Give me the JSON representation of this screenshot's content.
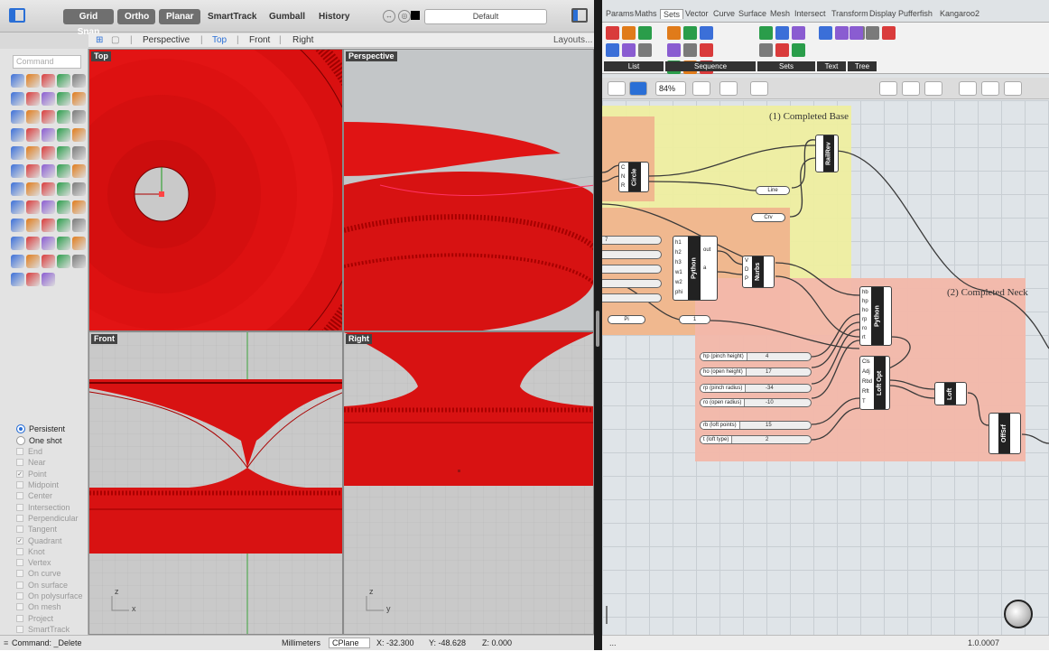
{
  "rhino": {
    "toolbar": {
      "grid_snap": "Grid Snap",
      "ortho": "Ortho",
      "planar": "Planar",
      "smarttrack": "SmartTrack",
      "gumball": "Gumball",
      "history": "History",
      "layer": "Default"
    },
    "viewport_tabs": [
      "Perspective",
      "Top",
      "Front",
      "Right"
    ],
    "active_tab": "Top",
    "layouts_label": "Layouts...",
    "command_placeholder": "Command",
    "viewports": {
      "top": "Top",
      "perspective": "Perspective",
      "front": "Front",
      "right": "Right"
    },
    "osnap": {
      "persistent": "Persistent",
      "one_shot": "One shot",
      "items": [
        {
          "label": "End",
          "checked": false
        },
        {
          "label": "Near",
          "checked": false
        },
        {
          "label": "Point",
          "checked": true
        },
        {
          "label": "Midpoint",
          "checked": false
        },
        {
          "label": "Center",
          "checked": false
        },
        {
          "label": "Intersection",
          "checked": false
        },
        {
          "label": "Perpendicular",
          "checked": false
        },
        {
          "label": "Tangent",
          "checked": false
        },
        {
          "label": "Quadrant",
          "checked": true
        },
        {
          "label": "Knot",
          "checked": false
        },
        {
          "label": "Vertex",
          "checked": false
        },
        {
          "label": "On curve",
          "checked": false
        },
        {
          "label": "On surface",
          "checked": false
        },
        {
          "label": "On polysurface",
          "checked": false
        },
        {
          "label": "On mesh",
          "checked": false
        },
        {
          "label": "Project",
          "checked": false
        },
        {
          "label": "SmartTrack",
          "checked": false
        }
      ]
    },
    "status": {
      "command": "Command: _Delete",
      "units": "Millimeters",
      "cplane": "CPlane",
      "x": "X: -32.300",
      "y": "Y: -48.628",
      "z": "Z: 0.000"
    },
    "axis_labels": {
      "front_z": "z",
      "front_x": "x",
      "right_z": "z",
      "right_y": "y"
    },
    "model_color": "#e01010"
  },
  "grasshopper": {
    "menu": [
      "Params",
      "Maths",
      "Sets",
      "Vector",
      "Curve",
      "Surface",
      "Mesh",
      "Intersect",
      "Transform",
      "Display",
      "Pufferfish",
      "Kangaroo2"
    ],
    "active_menu": "Sets",
    "ribbon_groups": [
      "List",
      "Sequence",
      "Sets",
      "Text",
      "Tree"
    ],
    "zoom": "84%",
    "groups": {
      "base_title": "(1) Completed Base",
      "neck_title": "(2) Completed Neck"
    },
    "components": {
      "circle": "Circle",
      "python1": "Python",
      "nurbs": "Nurbs",
      "railrev": "RailRev",
      "python2": "Python",
      "loft_opt": "Loft Opt",
      "loft": "Loft",
      "offsrf": "OffSrf"
    },
    "params": {
      "line": "Line",
      "crv": "Crv",
      "pi": "Pi",
      "one": "1"
    },
    "base_inputs": [
      "7",
      "",
      "",
      "",
      ""
    ],
    "sliders": [
      {
        "name": "hp (pinch height)",
        "value": "4"
      },
      {
        "name": "ho (open height)",
        "value": "17"
      },
      {
        "name": "rp (pinch radius)",
        "value": "-34"
      },
      {
        "name": "ro (open radius)",
        "value": "-10"
      },
      {
        "name": "rb (loft points)",
        "value": "15"
      },
      {
        "name": "t (loft type)",
        "value": "2"
      }
    ],
    "python1_inputs": [
      "h1",
      "h2",
      "h3",
      "w1",
      "w2",
      "phi"
    ],
    "python1_outputs": [
      "out",
      "a"
    ],
    "python2_inputs": [
      "hb",
      "hp",
      "ho",
      "rp",
      "ro",
      "rt"
    ],
    "python2_outputs": [
      "out",
      "a"
    ],
    "loft_opt_inputs": [
      "Cls",
      "Adj",
      "Rbd",
      "Rft",
      "T"
    ],
    "status_left": "...",
    "version": "1.0.0007",
    "group_colors": {
      "yellow": "#f0f0a0",
      "orange": "#f2b994",
      "neck": "#f5b9ac"
    }
  }
}
